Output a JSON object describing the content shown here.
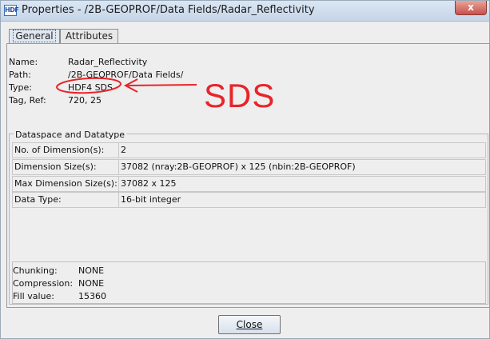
{
  "window": {
    "title": "Properties - /2B-GEOPROF/Data Fields/Radar_Reflectivity",
    "app_icon": "HDF",
    "close_glyph": "x"
  },
  "tabs": [
    {
      "label": "General",
      "active": true
    },
    {
      "label": "Attributes",
      "active": false
    }
  ],
  "general": {
    "name_label": "Name:",
    "name_value": "Radar_Reflectivity",
    "path_label": "Path:",
    "path_value": "/2B-GEOPROF/Data Fields/",
    "type_label": "Type:",
    "type_value": "HDF4 SDS",
    "tagref_label": "Tag, Ref:",
    "tagref_value": "720, 25"
  },
  "dataspace": {
    "title": "Dataspace and Datatype",
    "rows": [
      {
        "label": "No. of Dimension(s):",
        "value": "2"
      },
      {
        "label": "Dimension Size(s):",
        "value": "37082 (nray:2B-GEOPROF) x 125 (nbin:2B-GEOPROF)"
      },
      {
        "label": "Max Dimension Size(s):",
        "value": "37082 x 125"
      },
      {
        "label": "Data Type:",
        "value": "16-bit integer"
      }
    ]
  },
  "storage": {
    "chunking_label": "Chunking:",
    "chunking_value": "NONE",
    "compression_label": "Compression:",
    "compression_value": "NONE",
    "fill_label": "Fill value:",
    "fill_value": "15360"
  },
  "buttons": {
    "close_label": "Close"
  },
  "annotation": {
    "text": "SDS",
    "color": "#e8242a"
  }
}
